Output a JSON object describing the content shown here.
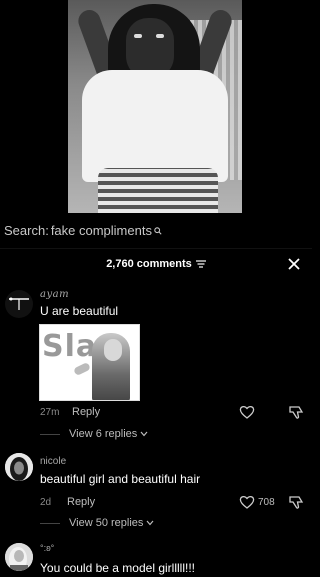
{
  "search": {
    "label": "Search:",
    "query": "fake compliments"
  },
  "comments_header": {
    "count_label": "2,760 comments"
  },
  "comments": [
    {
      "username": "ayam",
      "text": "U are beautiful",
      "sticker_text": "Slay",
      "time": "27m",
      "reply_label": "Reply",
      "view_replies": "View 6 replies"
    },
    {
      "username": "nicole",
      "text": "beautiful girl and beautiful hair",
      "time": "2d",
      "reply_label": "Reply",
      "likes": "708",
      "view_replies": "View 50 replies"
    },
    {
      "username": "°:ʚ°",
      "text": "You could be a model girlllll!!!"
    }
  ],
  "colors": {
    "background": "#000000",
    "text": "#ffffff",
    "muted": "#8a8a8a"
  }
}
